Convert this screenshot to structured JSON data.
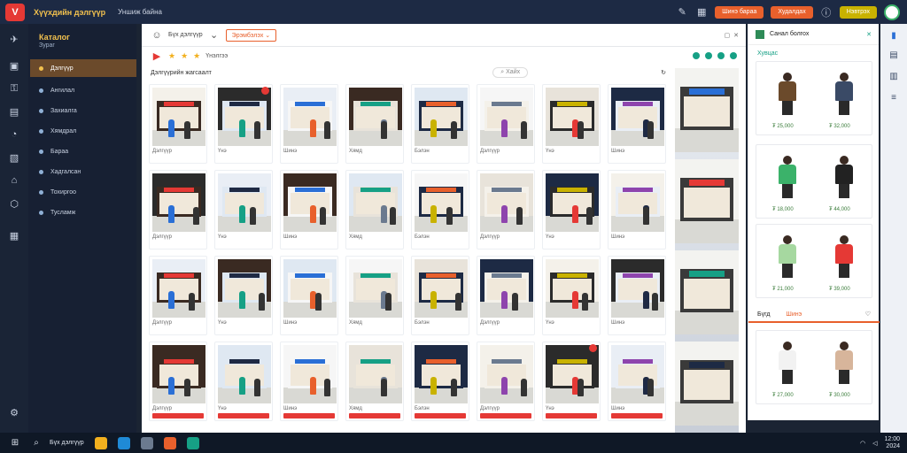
{
  "app": {
    "title": "Хүүхдийн дэлгүүр",
    "subtitle": "Уншиж байна"
  },
  "topbar": {
    "btn_primary": "Шинэ бараа",
    "btn_secondary": "Худалдах",
    "btn_yellow": "Нэвтрэх"
  },
  "sidebar": {
    "header": "Каталог",
    "header_sub": "Зураг",
    "items": [
      {
        "label": "Дэлгүүр"
      },
      {
        "label": "Ангилал"
      },
      {
        "label": "Захиалга"
      },
      {
        "label": "Хямдрал"
      },
      {
        "label": "Бараа"
      },
      {
        "label": "Хадгалсан"
      },
      {
        "label": "Тохиргоо"
      },
      {
        "label": "Тусламж"
      }
    ]
  },
  "main": {
    "toolbar_text": "Бүх дэлгүүр",
    "filter_chip": "Эрэмбэлэх",
    "rating_label": "Үнэлгээ",
    "subheader": "Дэлгүүрийн жагсаалт",
    "search_placeholder": "Хайх"
  },
  "gallery": {
    "captions": [
      "Дэлгүүр",
      "Үнэ",
      "Шинэ",
      "Хямд",
      "Бэлэн",
      "Дэлгүүр",
      "Үнэ",
      "Шинэ"
    ]
  },
  "right_panel": {
    "title": "Санал болгох",
    "card_title": "Хувцас",
    "tab_a": "Бүгд",
    "tab_b": "Шинэ",
    "prices": [
      "₮ 25,000",
      "₮ 32,000",
      "₮ 18,000",
      "₮ 44,000",
      "₮ 21,000",
      "₮ 39,000",
      "₮ 27,000",
      "₮ 30,000"
    ]
  },
  "taskbar": {
    "label": "Бүх дэлгүүр",
    "time": "12:00",
    "date": "2024"
  },
  "colors": {
    "accent": "#e8602c",
    "brand": "#f2c14e",
    "danger": "#e53935",
    "sidebar": "#172033"
  }
}
